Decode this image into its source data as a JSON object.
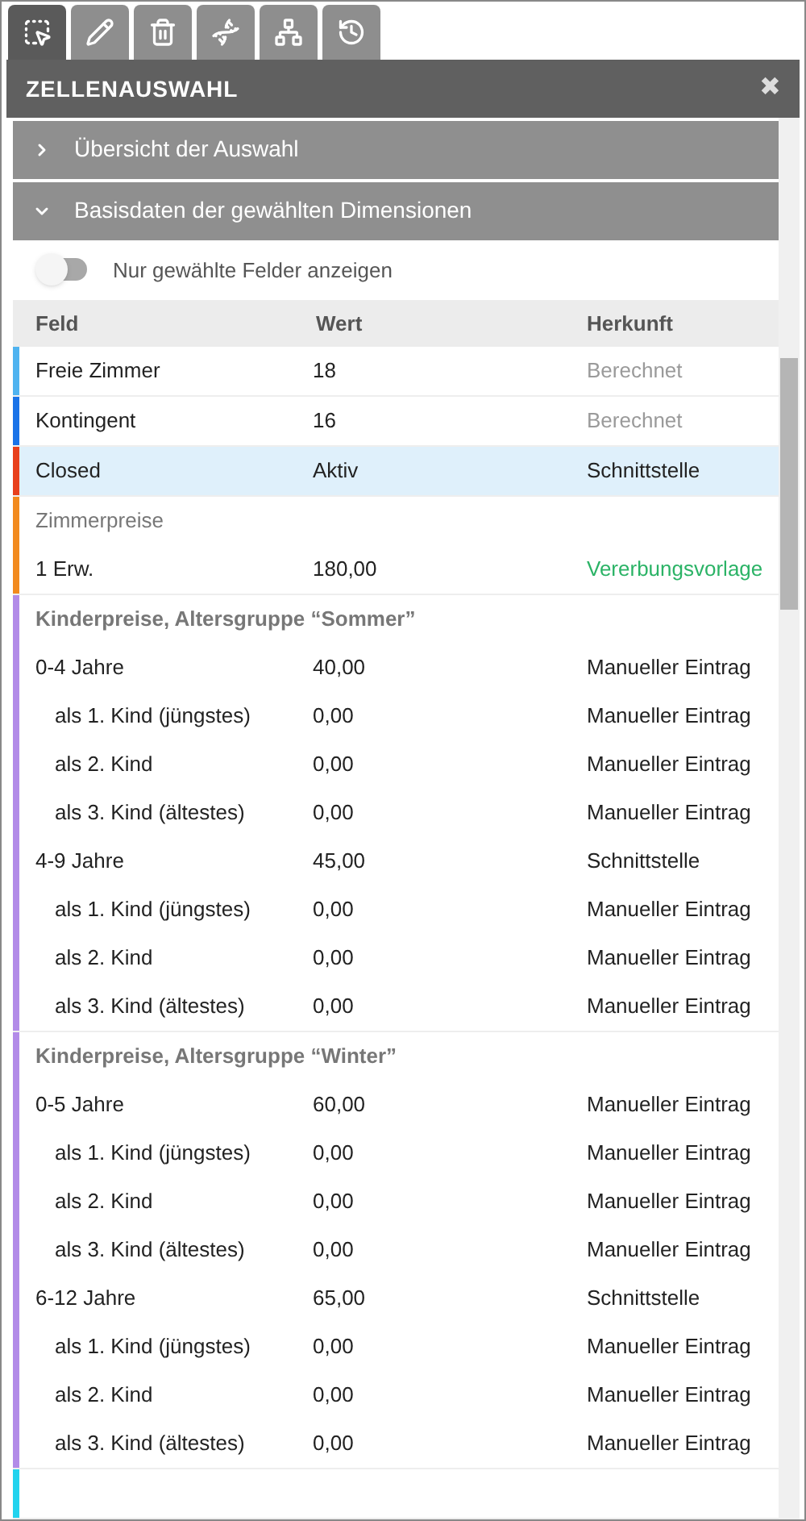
{
  "tabs": [
    {
      "selected": true
    },
    {
      "selected": false
    },
    {
      "selected": false
    },
    {
      "selected": false
    },
    {
      "selected": false
    },
    {
      "selected": false
    }
  ],
  "panel": {
    "title": "ZELLENAUSWAHL",
    "close": "✖"
  },
  "sections": [
    {
      "title": "Übersicht der Auswahl",
      "expanded": false
    },
    {
      "title": "Basisdaten der gewählten Dimensionen",
      "expanded": true
    }
  ],
  "toggle": {
    "label": "Nur gewählte Felder anzeigen",
    "on": false
  },
  "table": {
    "columns": [
      "Feld",
      "Wert",
      "Herkunft"
    ],
    "groups": [
      {
        "color": "#4fb3f0",
        "rows": [
          {
            "field": "Freie Zimmer",
            "value": "18",
            "origin": "Berechnet",
            "kind": "computed",
            "indented": false,
            "selected": false
          }
        ]
      },
      {
        "color": "#1a73e8",
        "rows": [
          {
            "field": "Kontingent",
            "value": "16",
            "origin": "Berechnet",
            "kind": "computed",
            "indented": false,
            "selected": false
          }
        ]
      },
      {
        "color": "#e8401c",
        "rows": [
          {
            "field": "Closed",
            "value": "Aktiv",
            "origin": "Schnittstelle",
            "kind": "interface",
            "indented": false,
            "selected": true
          }
        ]
      },
      {
        "color": "#f28a1e",
        "title": "Zimmerpreise",
        "title_bold": false,
        "rows": [
          {
            "field": "1 Erw.",
            "value": "180,00",
            "origin": "Vererbungsvorlage",
            "kind": "template",
            "indented": false,
            "selected": false
          }
        ]
      },
      {
        "color": "#b28be8",
        "title": "Kinderpreise, Altersgruppe “Sommer”",
        "title_bold": true,
        "rows": [
          {
            "field": "0-4 Jahre",
            "value": "40,00",
            "origin": "Manueller Eintrag",
            "kind": "manual",
            "indented": false,
            "selected": false
          },
          {
            "field": "als 1. Kind (jüngstes)",
            "value": "0,00",
            "origin": "Manueller Eintrag",
            "kind": "manual",
            "indented": true,
            "selected": false
          },
          {
            "field": "als 2. Kind",
            "value": "0,00",
            "origin": "Manueller Eintrag",
            "kind": "manual",
            "indented": true,
            "selected": false
          },
          {
            "field": "als 3. Kind (ältestes)",
            "value": "0,00",
            "origin": "Manueller Eintrag",
            "kind": "manual",
            "indented": true,
            "selected": false
          },
          {
            "field": "4-9 Jahre",
            "value": "45,00",
            "origin": "Schnittstelle",
            "kind": "interface",
            "indented": false,
            "selected": false
          },
          {
            "field": "als 1. Kind (jüngstes)",
            "value": "0,00",
            "origin": "Manueller Eintrag",
            "kind": "manual",
            "indented": true,
            "selected": false
          },
          {
            "field": "als 2. Kind",
            "value": "0,00",
            "origin": "Manueller Eintrag",
            "kind": "manual",
            "indented": true,
            "selected": false
          },
          {
            "field": "als 3. Kind (ältestes)",
            "value": "0,00",
            "origin": "Manueller Eintrag",
            "kind": "manual",
            "indented": true,
            "selected": false
          }
        ]
      },
      {
        "color": "#b28be8",
        "title": "Kinderpreise, Altersgruppe “Winter”",
        "title_bold": true,
        "rows": [
          {
            "field": "0-5 Jahre",
            "value": "60,00",
            "origin": "Manueller Eintrag",
            "kind": "manual",
            "indented": false,
            "selected": false
          },
          {
            "field": "als 1. Kind (jüngstes)",
            "value": "0,00",
            "origin": "Manueller Eintrag",
            "kind": "manual",
            "indented": true,
            "selected": false
          },
          {
            "field": "als 2. Kind",
            "value": "0,00",
            "origin": "Manueller Eintrag",
            "kind": "manual",
            "indented": true,
            "selected": false
          },
          {
            "field": "als 3. Kind (ältestes)",
            "value": "0,00",
            "origin": "Manueller Eintrag",
            "kind": "manual",
            "indented": true,
            "selected": false
          },
          {
            "field": "6-12 Jahre",
            "value": "65,00",
            "origin": "Schnittstelle",
            "kind": "interface",
            "indented": false,
            "selected": false
          },
          {
            "field": "als 1. Kind (jüngstes)",
            "value": "0,00",
            "origin": "Manueller Eintrag",
            "kind": "manual",
            "indented": true,
            "selected": false
          },
          {
            "field": "als 2. Kind",
            "value": "0,00",
            "origin": "Manueller Eintrag",
            "kind": "manual",
            "indented": true,
            "selected": false
          },
          {
            "field": "als 3. Kind (ältestes)",
            "value": "0,00",
            "origin": "Manueller Eintrag",
            "kind": "manual",
            "indented": true,
            "selected": false
          }
        ]
      },
      {
        "color": "#22d3ee"
      }
    ]
  }
}
